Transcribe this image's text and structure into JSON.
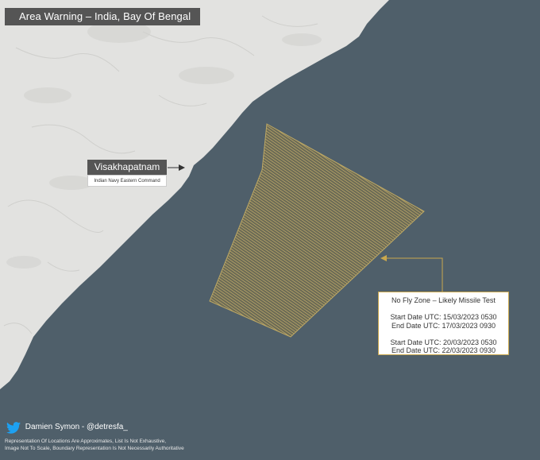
{
  "title": "Area Warning – India, Bay Of Bengal",
  "location": {
    "name": "Visakhapatnam",
    "subtitle": "Indian Navy Eastern Command"
  },
  "no_fly_zone": {
    "heading": "No Fly Zone – Likely Missile Test",
    "window1_start": "Start Date UTC: 15/03/2023 0530",
    "window1_end": "End Date UTC: 17/03/2023 0930",
    "window2_start": "Start Date UTC: 20/03/2023 0530",
    "window2_end": "End Date UTC: 22/03/2023 0930"
  },
  "credit": {
    "author": "Damien Symon - @detresfa_",
    "icon": "twitter-bird-icon"
  },
  "disclaimer": {
    "line1": "Representation Of Locations Are Approximates, List Is Not Exhaustive,",
    "line2": "Image Not To Scale, Boundary Representation Is Not Necessarily Authoritative"
  },
  "colors": {
    "sea": "#4f5f6a",
    "land": "#e3e3e1",
    "zone_hatch": "#bfa964",
    "label_box": "#555555",
    "accent": "#c9a74d"
  }
}
